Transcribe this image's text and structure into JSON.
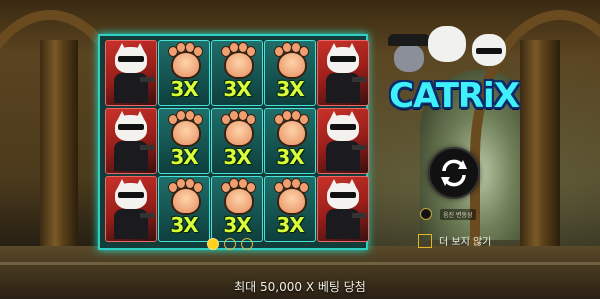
{
  "logo": {
    "text": "CATRiX"
  },
  "reels": {
    "grid": [
      [
        "cat",
        "paw",
        "paw",
        "paw",
        "cat"
      ],
      [
        "cat",
        "paw",
        "paw",
        "paw",
        "cat"
      ],
      [
        "cat",
        "paw",
        "paw",
        "paw",
        "cat"
      ]
    ],
    "multiplier_label": "3X"
  },
  "pager": {
    "pages": 3,
    "active_index": 0
  },
  "controls": {
    "spin_icon": "refresh-arrows-icon",
    "sound_label": "음진 변동성",
    "dont_show_label": "더 보지 않기",
    "dont_show_checked": false
  },
  "footer": {
    "max_win_text": "최대 50,000 X 베팅 당첨"
  },
  "colors": {
    "accent_yellow": "#ffd21a",
    "reel_border": "#2fd0c4",
    "multiplier": "#d8ff3a"
  }
}
